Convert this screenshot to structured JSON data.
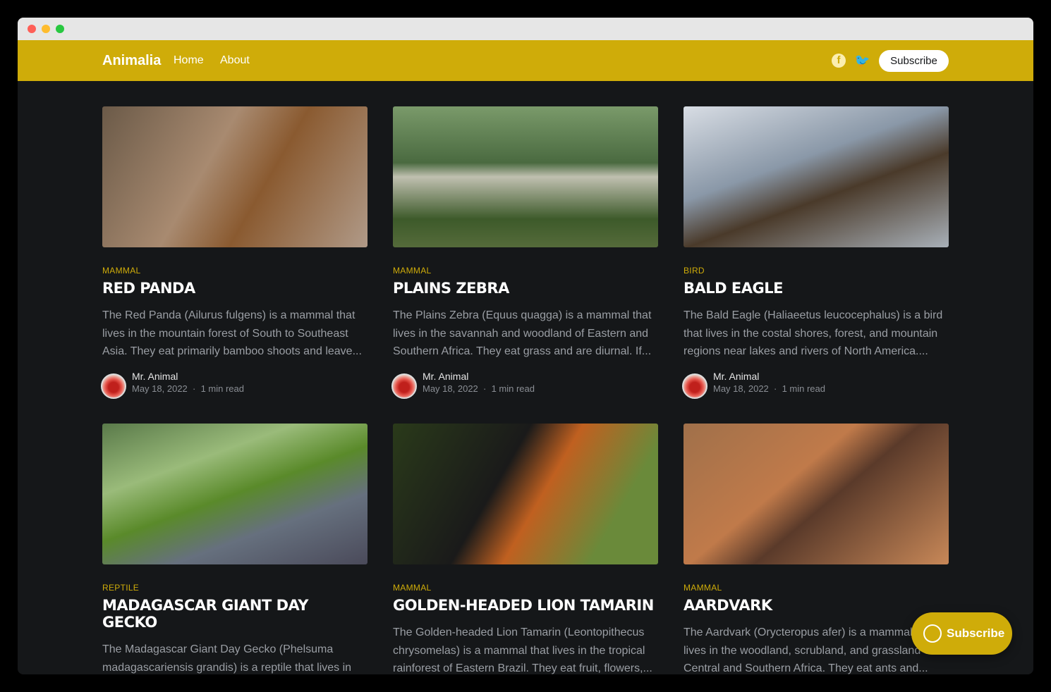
{
  "header": {
    "brand": "Animalia",
    "nav": [
      "Home",
      "About"
    ],
    "subscribe": "Subscribe",
    "social": [
      "facebook-icon",
      "twitter-icon"
    ]
  },
  "colors": {
    "accent": "#cfac09",
    "background": "#151719"
  },
  "posts": [
    {
      "tag": "MAMMAL",
      "title": "Red Panda",
      "excerpt": "The Red Panda (Ailurus fulgens) is a mammal that lives in the mountain forest of South to Southeast Asia. They eat primarily bamboo shoots and leave...",
      "author": "Mr. Animal",
      "date": "May 18, 2022",
      "read": "1 min read"
    },
    {
      "tag": "MAMMAL",
      "title": "Plains Zebra",
      "excerpt": "The Plains Zebra (Equus quagga) is a mammal that lives in the savannah and woodland of Eastern and Southern Africa. They eat grass and are diurnal. If...",
      "author": "Mr. Animal",
      "date": "May 18, 2022",
      "read": "1 min read"
    },
    {
      "tag": "BIRD",
      "title": "Bald Eagle",
      "excerpt": "The Bald Eagle (Haliaeetus leucocephalus) is a bird that lives in the costal shores, forest, and mountain regions near lakes and rivers of North America....",
      "author": "Mr. Animal",
      "date": "May 18, 2022",
      "read": "1 min read"
    },
    {
      "tag": "REPTILE",
      "title": "Madagascar Giant Day Gecko",
      "excerpt": "The Madagascar Giant Day Gecko (Phelsuma madagascariensis grandis) is a reptile that lives in the forest of Northern Madagascar. They eat...",
      "author": "",
      "date": "",
      "read": ""
    },
    {
      "tag": "MAMMAL",
      "title": "Golden-headed Lion Tamarin",
      "excerpt": "The Golden-headed Lion Tamarin (Leontopithecus chrysomelas) is a mammal that lives in the tropical rainforest of Eastern Brazil. They eat fruit, flowers,...",
      "author": "",
      "date": "",
      "read": ""
    },
    {
      "tag": "MAMMAL",
      "title": "Aardvark",
      "excerpt": "The Aardvark (Orycteropus afer) is a mammal that lives in the woodland, scrubland, and grassland of Central and Southern Africa. They eat ants and...",
      "author": "",
      "date": "",
      "read": ""
    }
  ],
  "floating": {
    "subscribe": "Subscribe"
  }
}
